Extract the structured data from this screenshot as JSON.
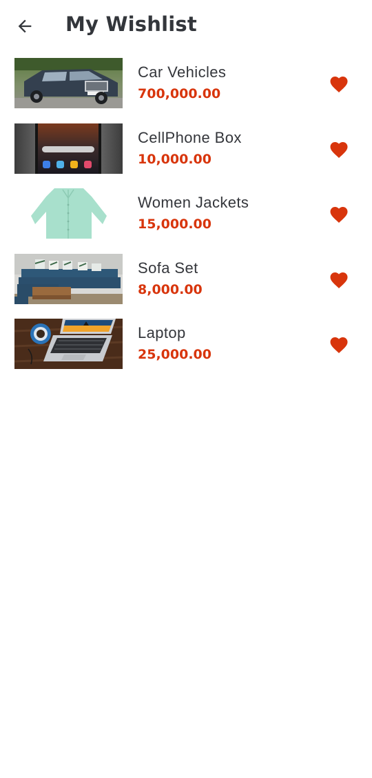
{
  "header": {
    "back_icon": "arrow-left-icon",
    "title": "My Wishlist"
  },
  "colors": {
    "accent": "#d8350c",
    "text": "#34363b"
  },
  "items": [
    {
      "name": "Car Vehicles",
      "price": "700,000.00",
      "image": "car-image",
      "favorited": true,
      "icon": "heart-icon"
    },
    {
      "name": "CellPhone Box",
      "price": "10,000.00",
      "image": "cellphone-image",
      "favorited": true,
      "icon": "heart-icon"
    },
    {
      "name": "Women Jackets",
      "price": "15,000.00",
      "image": "jacket-image",
      "favorited": true,
      "icon": "heart-icon"
    },
    {
      "name": "Sofa Set",
      "price": "8,000.00",
      "image": "sofa-image",
      "favorited": true,
      "icon": "heart-icon"
    },
    {
      "name": "Laptop",
      "price": "25,000.00",
      "image": "laptop-image",
      "favorited": true,
      "icon": "heart-icon"
    }
  ]
}
